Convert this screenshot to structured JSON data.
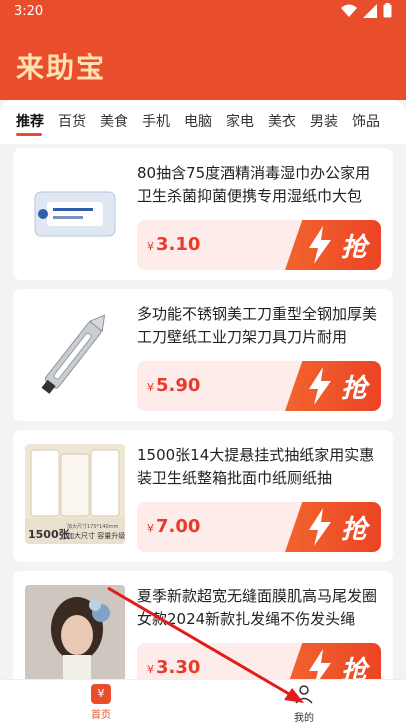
{
  "status": {
    "time": "3:20"
  },
  "app": {
    "title": "来助宝"
  },
  "tabs": [
    "推荐",
    "百货",
    "美食",
    "手机",
    "电脑",
    "家电",
    "美衣",
    "男装",
    "饰品"
  ],
  "products": [
    {
      "name": "80抽含75度酒精消毒湿巾办公家用卫生杀菌抑菌便携专用湿纸巾大包",
      "currency": "¥",
      "price": "3.10",
      "button": "抢"
    },
    {
      "name": "多功能不锈钢美工刀重型全钢加厚美工刀壁纸工业刀架刀具刀片耐用",
      "currency": "¥",
      "price": "5.90",
      "button": "抢"
    },
    {
      "name": "1500张14大提悬挂式抽纸家用实惠装卫生纸整箱批面巾纸厕纸抽",
      "currency": "¥",
      "price": "7.00",
      "button": "抢",
      "thumb_text": {
        "count": "1500张",
        "caption": "加大尺寸 容量升级",
        "size": "加大尺寸175*140mm"
      }
    },
    {
      "name": "夏季新款超宽无缝面膜肌高马尾发圈女款2024新款扎发绳不伤发头绳",
      "currency": "¥",
      "price": "3.30",
      "button": "抢"
    }
  ],
  "bottom_nav": {
    "home": "首页",
    "home_icon_text": "¥",
    "mine": "我的"
  },
  "colors": {
    "brand": "#e94e2c",
    "title": "#ffe0b0",
    "price": "#e93b2b"
  }
}
